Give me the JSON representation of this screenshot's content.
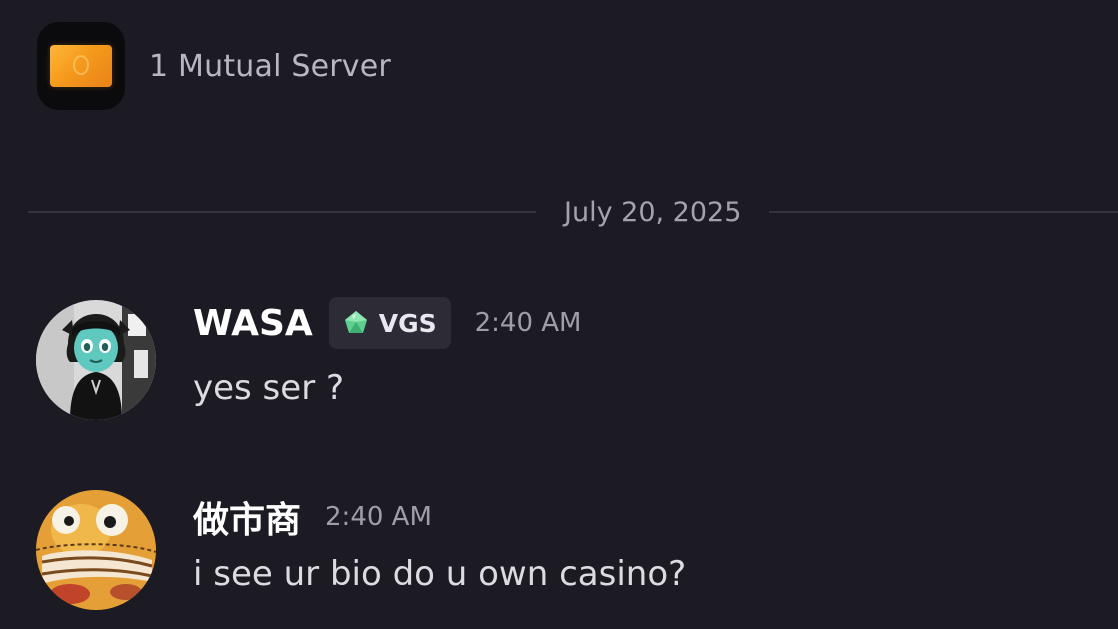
{
  "mutual_servers": {
    "label": "1 Mutual Server",
    "icon": "server-card-icon"
  },
  "date_divider": {
    "date": "July 20, 2025"
  },
  "messages": [
    {
      "username": "WASA",
      "tag": {
        "icon": "green-gem-icon",
        "label": "VGS"
      },
      "timestamp": "2:40 AM",
      "text": "yes ser ?",
      "avatar": "teal-character-avatar"
    },
    {
      "username": "做市商",
      "timestamp": "2:40 AM",
      "text": "i see ur bio do u own casino?",
      "avatar": "orange-face-avatar"
    }
  ],
  "colors": {
    "background": "#1c1b24",
    "secondary_text": "#b7b7c0",
    "tag_background": "#2d2c36",
    "gem_green": "#5fcf8f",
    "server_icon_orange": "#f59a1c"
  }
}
